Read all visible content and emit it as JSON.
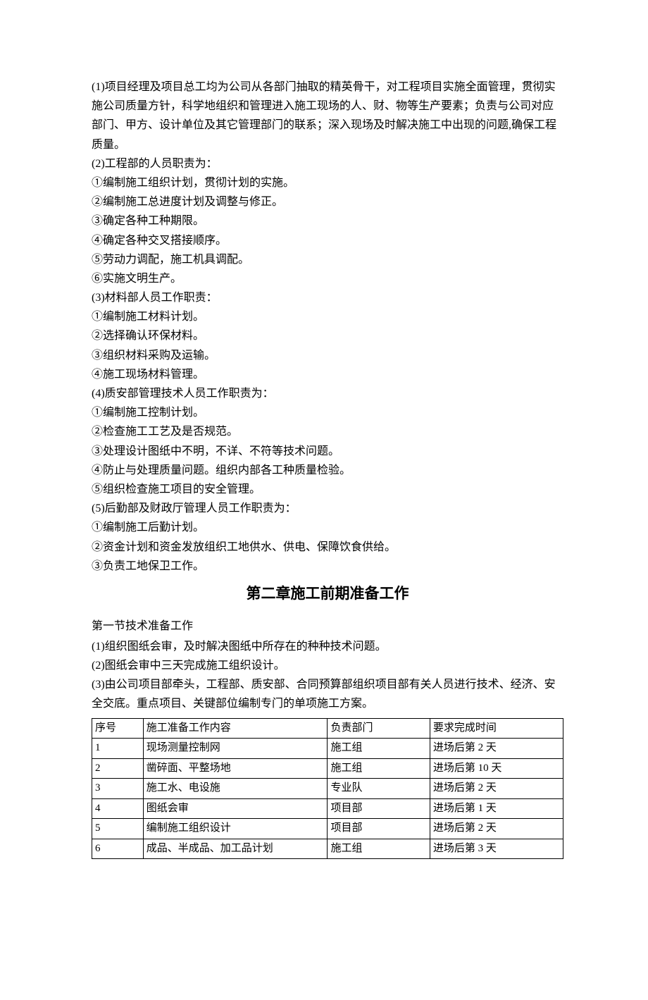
{
  "paragraphs": [
    "(1)项目经理及项目总工均为公司从各部门抽取的精英骨干，对工程项目实施全面管理，贯彻实施公司质量方针，科学地组织和管理进入施工现场的人、财、物等生产要素；负责与公司对应部门、甲方、设计单位及其它管理部门的联系；深入现场及时解决施工中出现的问题,确保工程质量。",
    "(2)工程部的人员职责为：",
    "①编制施工组织计划，贯彻计划的实施。",
    "②编制施工总进度计划及调整与修正。",
    "③确定各种工种期限。",
    "④确定各种交叉搭接顺序。",
    "⑤劳动力调配，施工机具调配。",
    "⑥实施文明生产。",
    "(3)材料部人员工作职责：",
    "①编制施工材料计划。",
    "②选择确认环保材料。",
    "③组织材料采购及运输。",
    "④施工现场材料管理。",
    "(4)质安部管理技术人员工作职责为：",
    "①编制施工控制计划。",
    "②检查施工工艺及是否规范。",
    "③处理设计图纸中不明，不详、不符等技术问题。",
    "④防止与处理质量问题。组织内部各工种质量检验。",
    "⑤组织检查施工项目的安全管理。",
    "(5)后勤部及财政厅管理人员工作职责为：",
    "①编制施工后勤计划。",
    "②资金计划和资金发放组织工地供水、供电、保障饮食供给。",
    "③负责工地保卫工作。"
  ],
  "chapterTitle": "第二章施工前期准备工作",
  "sectionTitle": "第一节技术准备工作",
  "sectionParagraphs": [
    "(1)组织图纸会审，及时解决图纸中所存在的种种技术问题。",
    "(2)图纸会审中三天完成施工组织设计。",
    "(3)由公司项目部牵头，工程部、质安部、合同预算部组织项目部有关人员进行技术、经济、安全交底。重点项目、关键部位编制专门的单项施工方案。"
  ],
  "table": {
    "headers": [
      "序号",
      "施工准备工作内容",
      "负责部门",
      "要求完成时间"
    ],
    "rows": [
      [
        "1",
        "现场测量控制网",
        "施工组",
        "进场后第 2 天"
      ],
      [
        "2",
        "凿碎面、平整场地",
        "施工组",
        "进场后第 10 天"
      ],
      [
        "3",
        "施工水、电设施",
        "专业队",
        "进场后第 2 天"
      ],
      [
        "4",
        "图纸会审",
        "项目部",
        "进场后第 1 天"
      ],
      [
        "5",
        "编制施工组织设计",
        "项目部",
        "进场后第 2 天"
      ],
      [
        "6",
        "成品、半成品、加工品计划",
        "施工组",
        "进场后第 3 天"
      ]
    ]
  }
}
